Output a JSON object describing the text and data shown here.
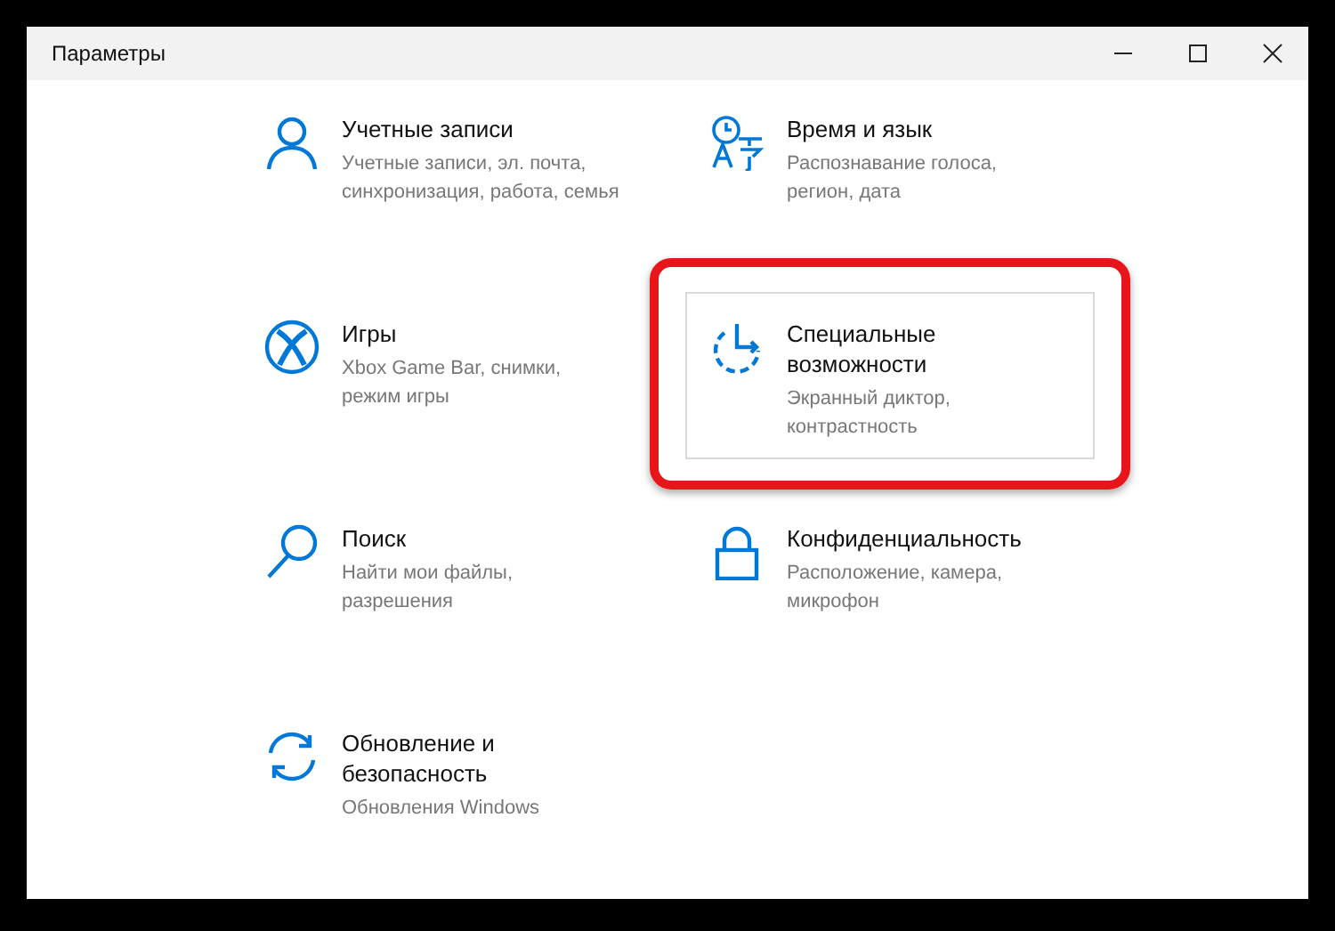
{
  "window": {
    "title": "Параметры"
  },
  "tiles": [
    {
      "kind": "person",
      "title": "Учетные записи",
      "description": "Учетные записи, эл. почта, синхронизация, работа, семья",
      "selected": false
    },
    {
      "kind": "language",
      "title": "Время и язык",
      "description": "Распознавание голоса, регион, дата",
      "selected": false
    },
    {
      "kind": "xbox",
      "title": "Игры",
      "description": "Xbox Game Bar, снимки, режим игры",
      "selected": false
    },
    {
      "kind": "accessibility",
      "title": "Специальные возможности",
      "description": "Экранный диктор, контрастность",
      "selected": true
    },
    {
      "kind": "search",
      "title": "Поиск",
      "description": "Найти мои файлы, разрешения",
      "selected": false
    },
    {
      "kind": "lock",
      "title": "Конфиденциальность",
      "description": "Расположение, камера, микрофон",
      "selected": false
    },
    {
      "kind": "sync",
      "title": "Обновление и безопасность",
      "description": "Обновления Windows",
      "selected": false
    }
  ]
}
